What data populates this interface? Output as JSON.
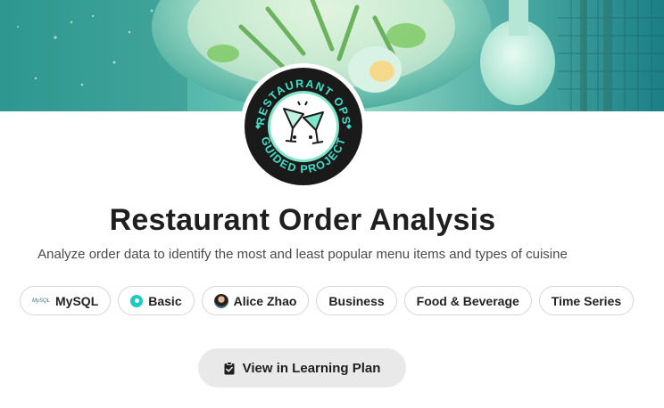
{
  "badge": {
    "top_text": "RESTAURANT OPS",
    "bottom_text": "GUIDED PROJECT",
    "icon": "cocktail-glasses-icon",
    "colors": {
      "ring": "#1a1a1a",
      "accent": "#3fe0c8",
      "inner": "#ffffff"
    }
  },
  "project": {
    "title": "Restaurant Order Analysis",
    "description": "Analyze order data to identify the most and least popular menu items and types of cuisine"
  },
  "tags": [
    {
      "label": "MySQL",
      "icon": "mysql-logo-icon"
    },
    {
      "label": "Basic",
      "icon": "difficulty-dot-icon"
    },
    {
      "label": "Alice Zhao",
      "icon": "instructor-avatar"
    },
    {
      "label": "Business"
    },
    {
      "label": "Food & Beverage"
    },
    {
      "label": "Time Series"
    }
  ],
  "mysql_logo_text": "MySQL",
  "actions": {
    "view_plan_label": "View in Learning Plan",
    "view_plan_icon": "clipboard-check-icon"
  }
}
